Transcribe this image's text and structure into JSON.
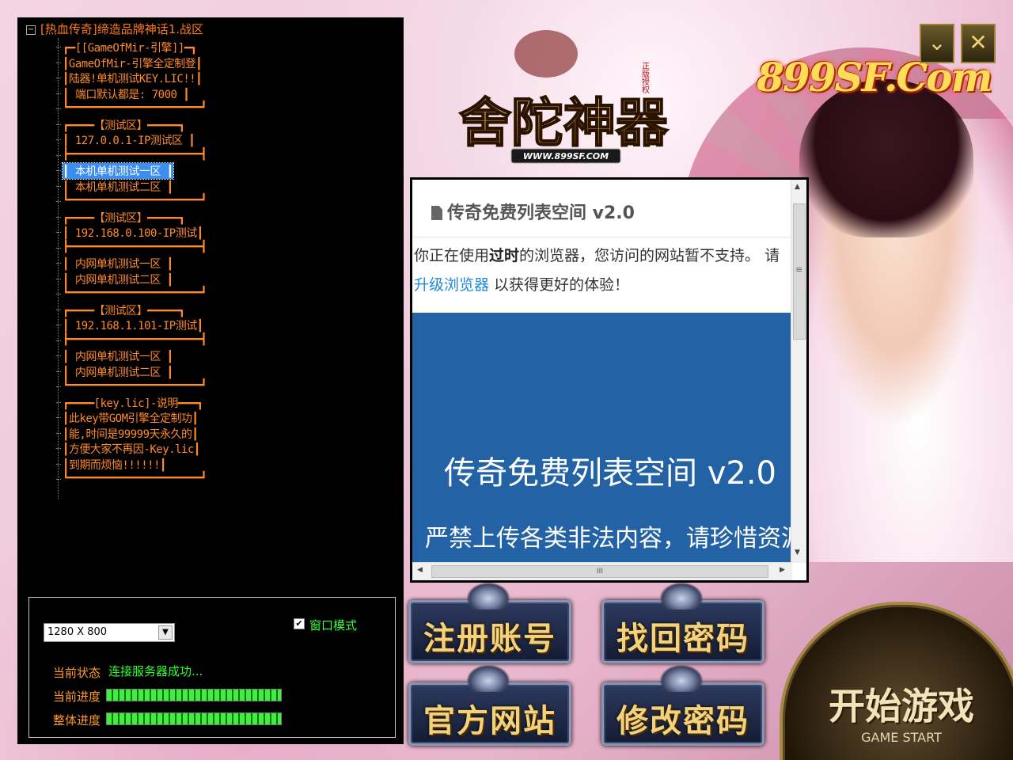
{
  "window": {
    "brand": "899SF.Com",
    "minimize_glyph": "⌄",
    "close_glyph": "✕"
  },
  "logo": {
    "title": "舍陀神器",
    "badge": "正版授权",
    "url": "WWW.899SF.COM"
  },
  "server_tree": {
    "root": "[热血传奇]缔造品牌神话1.战区",
    "items": [
      "┏━[[GameOfMir-引擎]]━┓",
      "┃GameOfMir-引擎全定制登┃",
      "┃陆器!单机测试KEY.LIC!!┃",
      "┃ 端口默认都是: 7000 ┃",
      "┗━━━━━━━━━━━━━━━━━━━━━┛",
      "┏━━━━【测试区】━━━━━┓",
      "┃ 127.0.0.1-IP测试区 ┃",
      "┣━━━━━━━━━━━━━━━━━━━━━┫",
      "┃   本机单机测试一区   ┃",
      "┃   本机单机测试二区   ┃",
      "┗━━━━━━━━━━━━━━━━━━━━━┛",
      "┏━━━━【测试区】━━━━━┓",
      "┃ 192.168.0.100-IP测试┃",
      "┣━━━━━━━━━━━━━━━━━━━━━┫",
      "┃   内网单机测试一区   ┃",
      "┃   内网单机测试二区   ┃",
      "┗━━━━━━━━━━━━━━━━━━━━━┛",
      "┏━━━━【测试区】━━━━━┓",
      "┃ 192.168.1.101-IP测试┃",
      "┣━━━━━━━━━━━━━━━━━━━━━┫",
      "┃   内网单机测试一区   ┃",
      "┃   内网单机测试二区   ┃",
      "┗━━━━━━━━━━━━━━━━━━━━━┛",
      "┏━━━━[key.lic]-说明━━━┓",
      "┃此key带GOM引擎全定制功┃",
      "┃能,时间是99999天永久的┃",
      "┃方便大家不再因-Key.lic┃",
      "┃到期而烦恼!!!!!!┃",
      "┗━━━━━━━━━━━━━━━━━━━━━┛"
    ],
    "selected_index": 8
  },
  "controls": {
    "resolution": "1280 X 800",
    "dropdown_glyph": "▼",
    "window_mode_label": "窗口模式",
    "window_mode_checked": "✔",
    "status_label": "当前状态",
    "status_value": "连接服务器成功...",
    "current_progress_label": "当前进度",
    "total_progress_label": "整体进度",
    "current_progress": 1.0,
    "total_progress": 1.0
  },
  "browser": {
    "title": "传奇免费列表空间 v2.0",
    "warn_pre": "你正在使用",
    "warn_bold": "过时",
    "warn_mid": "的浏览器，您访问的网站暂不支持。 请",
    "warn_link": "升级浏览器",
    "warn_post": " 以获得更好的体验！",
    "hero_title": "传奇免费列表空间 v2.0",
    "hero_sub": "严禁上传各类非法内容，请珍惜资源",
    "scroll_up": "▲",
    "scroll_down": "▼",
    "scroll_left": "◀",
    "scroll_right": "▶",
    "grip_v": "≡",
    "grip_h": "III"
  },
  "buttons": {
    "register": "注册账号",
    "recover": "找回密码",
    "website": "官方网站",
    "change_password": "修改密码",
    "start": "开始游戏",
    "start_sub": "GAME START"
  },
  "colors": {
    "tree_text": "#ff8a2a",
    "status_green": "#2aff2a",
    "selected_bg": "#3b8ef0",
    "browser_hero": "#2362a5",
    "button_gold": "#f2d27a"
  }
}
